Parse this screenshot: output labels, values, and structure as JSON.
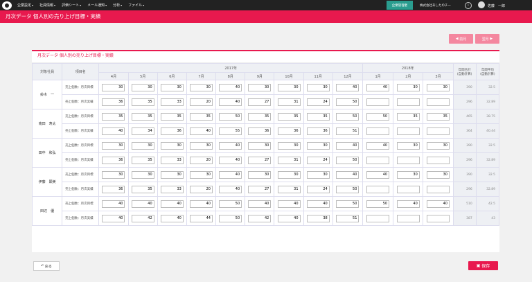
{
  "nav": {
    "menu": [
      "企業設定",
      "社員情報",
      "評価シート",
      "メール通知",
      "分析",
      "ファイル"
    ],
    "admin_button": "企業管理者",
    "company": "株式会社あしたのチー",
    "user": "佐藤　一郎",
    "info_icon": "i"
  },
  "page": {
    "title": "月次データ 個人別の売り上げ目標・実績"
  },
  "buttons": {
    "prev": "前月",
    "next": "翌月",
    "back": "戻る",
    "save": "保存"
  },
  "panel": {
    "title": "月次データ 個人別の売り上げ目標・実績"
  },
  "table": {
    "col_employee": "対象社員",
    "col_item": "項目名",
    "year_2017": "2017年",
    "year_2018": "2018年",
    "col_total": "年間合計\n(自動計算)",
    "col_avg": "年間平均\n(自動計算)",
    "months_2017": [
      "4月",
      "5月",
      "6月",
      "7月",
      "8月",
      "9月",
      "10月",
      "11月",
      "12月"
    ],
    "months_2018": [
      "1月",
      "2月",
      "3月"
    ],
    "employees": [
      {
        "name": "鈴木　一",
        "rows": [
          {
            "label": "売上個数：月次目標",
            "values": [
              "30",
              "30",
              "30",
              "30",
              "40",
              "30",
              "30",
              "30",
              "40",
              "40",
              "30",
              "30"
            ],
            "total": "390",
            "avg": "32.5"
          },
          {
            "label": "売上個数：月次実績",
            "values": [
              "36",
              "35",
              "33",
              "20",
              "40",
              "27",
              "31",
              "24",
              "50",
              "",
              "",
              ""
            ],
            "total": "296",
            "avg": "32.89"
          }
        ]
      },
      {
        "name": "南田　寿太",
        "rows": [
          {
            "label": "売上個数：月次目標",
            "values": [
              "35",
              "35",
              "35",
              "35",
              "50",
              "35",
              "35",
              "35",
              "50",
              "50",
              "35",
              "35"
            ],
            "total": "465",
            "avg": "38.75"
          },
          {
            "label": "売上個数：月次実績",
            "values": [
              "40",
              "34",
              "36",
              "40",
              "55",
              "36",
              "36",
              "36",
              "51",
              "",
              "",
              ""
            ],
            "total": "364",
            "avg": "40.44"
          }
        ]
      },
      {
        "name": "田中　和弘",
        "rows": [
          {
            "label": "売上個数：月次目標",
            "values": [
              "30",
              "30",
              "30",
              "30",
              "40",
              "30",
              "30",
              "30",
              "40",
              "40",
              "30",
              "30"
            ],
            "total": "390",
            "avg": "32.5"
          },
          {
            "label": "売上個数：月次実績",
            "values": [
              "36",
              "35",
              "33",
              "20",
              "40",
              "27",
              "31",
              "24",
              "50",
              "",
              "",
              ""
            ],
            "total": "296",
            "avg": "32.89"
          }
        ]
      },
      {
        "name": "伊藤　顕美",
        "rows": [
          {
            "label": "売上個数：月次目標",
            "values": [
              "30",
              "30",
              "30",
              "30",
              "40",
              "30",
              "30",
              "30",
              "40",
              "40",
              "30",
              "30"
            ],
            "total": "390",
            "avg": "32.5"
          },
          {
            "label": "売上個数：月次実績",
            "values": [
              "36",
              "35",
              "33",
              "20",
              "40",
              "27",
              "31",
              "24",
              "50",
              "",
              "",
              ""
            ],
            "total": "296",
            "avg": "32.89"
          }
        ]
      },
      {
        "name": "田辺　優",
        "rows": [
          {
            "label": "売上個数：月次目標",
            "values": [
              "40",
              "40",
              "40",
              "40",
              "50",
              "40",
              "40",
              "40",
              "50",
              "50",
              "40",
              "40"
            ],
            "total": "510",
            "avg": "42.5"
          },
          {
            "label": "売上個数：月次実績",
            "values": [
              "40",
              "42",
              "40",
              "44",
              "50",
              "42",
              "40",
              "38",
              "51",
              "",
              "",
              ""
            ],
            "total": "387",
            "avg": "43"
          }
        ]
      }
    ]
  },
  "colors": {
    "accent": "#e8194e",
    "accent_light": "#f4879f",
    "admin": "#2a9d8f"
  }
}
